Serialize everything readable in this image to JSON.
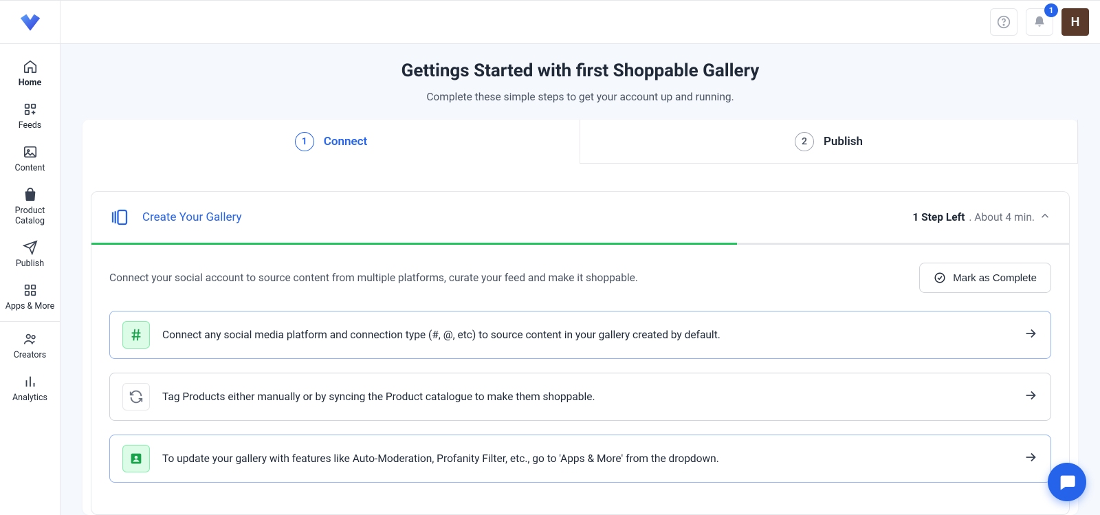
{
  "notifications": {
    "count": "1"
  },
  "user": {
    "initial": "H"
  },
  "sidebar": {
    "items": [
      {
        "label": "Home"
      },
      {
        "label": "Feeds"
      },
      {
        "label": "Content"
      },
      {
        "label": "Product Catalog"
      },
      {
        "label": "Publish"
      },
      {
        "label": "Apps & More"
      },
      {
        "label": "Creators"
      },
      {
        "label": "Analytics"
      }
    ]
  },
  "page": {
    "title": "Gettings Started with first Shoppable Gallery",
    "subtitle": "Complete these simple steps to get your account up and running."
  },
  "tabs": [
    {
      "num": "1",
      "label": "Connect"
    },
    {
      "num": "2",
      "label": "Publish"
    }
  ],
  "gallery": {
    "title": "Create Your Gallery",
    "steps_left": "1 Step Left",
    "time_est": ". About 4 min.",
    "description": "Connect your social account to source content from multiple platforms, curate your feed and make it shoppable.",
    "mark_complete": "Mark as Complete",
    "steps": [
      {
        "text": "Connect any social media platform and connection type (#, @, etc) to source content in your gallery created by default."
      },
      {
        "text": "Tag Products either manually or by syncing the Product catalogue to make them shoppable."
      },
      {
        "text": "To update your gallery with features like Auto-Moderation, Profanity Filter, etc., go to 'Apps & More' from the dropdown."
      }
    ]
  }
}
